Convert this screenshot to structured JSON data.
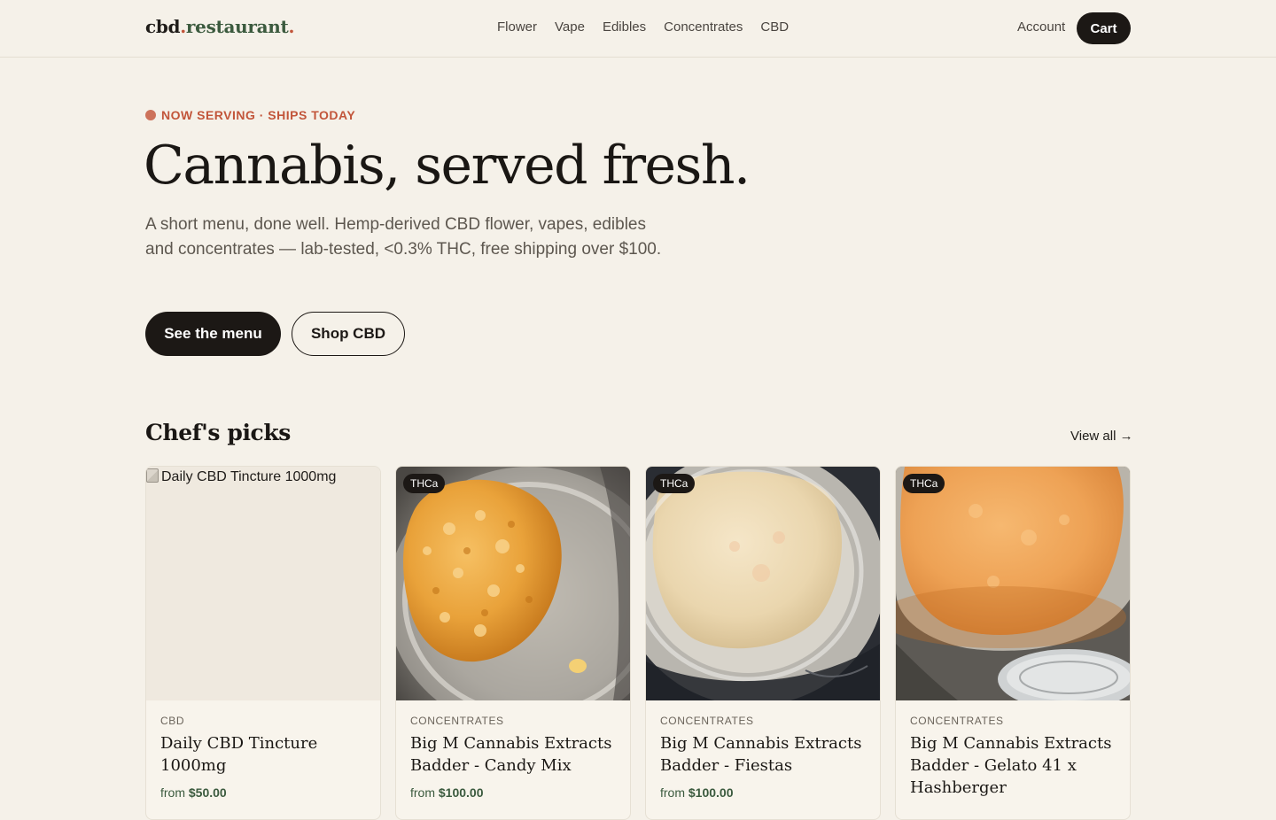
{
  "header": {
    "logo_main": "cbd",
    "logo_dot": ".",
    "logo_rest": "restaurant",
    "logo_end": ".",
    "nav": [
      {
        "label": "Flower"
      },
      {
        "label": "Vape"
      },
      {
        "label": "Edibles"
      },
      {
        "label": "Concentrates"
      },
      {
        "label": "CBD"
      }
    ],
    "account_label": "Account",
    "cart_label": "Cart"
  },
  "hero": {
    "eyebrow": "NOW SERVING · SHIPS TODAY",
    "title": "Cannabis, served fresh.",
    "subtitle": "A short menu, done well. Hemp-derived CBD flower, vapes, edibles and concentrates — lab-tested, <0.3% THC, free shipping over $100.",
    "primary_button": "See the menu",
    "secondary_button": "Shop CBD"
  },
  "picks": {
    "title": "Chef's picks",
    "view_all": "View all →",
    "items": [
      {
        "image_alt": "Daily CBD Tincture 1000mg",
        "badge": "",
        "category": "CBD",
        "name": "Daily CBD Tincture 1000mg",
        "price_prefix": "from",
        "price": "$50.00"
      },
      {
        "image_alt": "",
        "badge": "THCa",
        "category": "CONCENTRATES",
        "name": "Big M Cannabis Extracts Badder - Candy Mix",
        "price_prefix": "from",
        "price": "$100.00"
      },
      {
        "image_alt": "",
        "badge": "THCa",
        "category": "CONCENTRATES",
        "name": "Big M Cannabis Extracts Badder - Fiestas",
        "price_prefix": "from",
        "price": "$100.00"
      },
      {
        "image_alt": "",
        "badge": "THCa",
        "category": "CONCENTRATES",
        "name": "Big M Cannabis Extracts Badder - Gelato 41 x Hashberger",
        "price_prefix": "from",
        "price": ""
      }
    ]
  },
  "colors": {
    "background": "#f5f1e9",
    "accent": "#c2553a",
    "dark": "#1c1815",
    "price_green": "#3b5a3e"
  }
}
